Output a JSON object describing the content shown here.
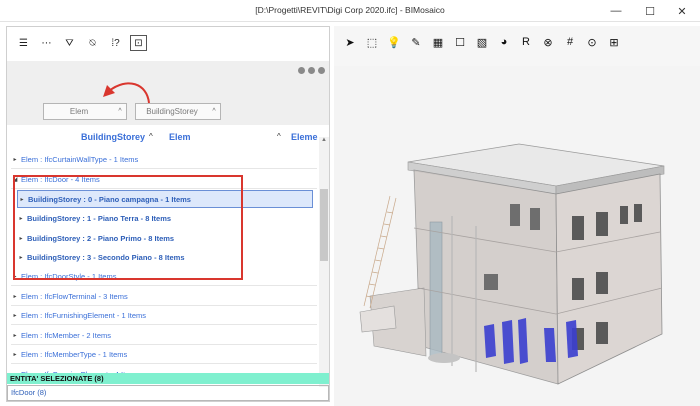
{
  "window": {
    "title": "[D:\\Progetti\\REVIT\\Digi Corp 2020.ifc] - BIMosaico",
    "min_glyph": "—",
    "max_glyph": "☐",
    "close_glyph": "✕"
  },
  "left_toolbar": [
    {
      "name": "list-icon",
      "glyph": "☰"
    },
    {
      "name": "collapse-icon",
      "glyph": "⋯"
    },
    {
      "name": "filter-icon",
      "glyph": "⛛"
    },
    {
      "name": "filter-clear-icon",
      "glyph": "⍉"
    },
    {
      "name": "properties-icon",
      "glyph": "⁞?"
    },
    {
      "name": "inspect-icon",
      "glyph": "⊡"
    }
  ],
  "grouping": {
    "chips": [
      "Elem",
      "BuildingStorey"
    ],
    "caret": "^"
  },
  "columns": [
    "BuildingStorey",
    "Elem",
    "Eleme"
  ],
  "tree": [
    {
      "level": 0,
      "expanded": false,
      "text": "Elem : IfcCurtainWallType - 1 Items"
    },
    {
      "level": 0,
      "expanded": true,
      "text": "Elem : IfcDoor - 4 Items"
    },
    {
      "level": 1,
      "expanded": false,
      "text": "BuildingStorey : 0 - Piano campagna - 1 Items",
      "selected": true
    },
    {
      "level": 1,
      "expanded": false,
      "text": "BuildingStorey : 1 - Piano Terra - 8 Items"
    },
    {
      "level": 1,
      "expanded": false,
      "text": "BuildingStorey : 2 - Piano Primo - 8 Items"
    },
    {
      "level": 1,
      "expanded": false,
      "text": "BuildingStorey : 3 - Secondo Piano - 8 Items"
    },
    {
      "level": 0,
      "expanded": false,
      "text": "Elem : IfcDoorStyle - 1 Items"
    },
    {
      "level": 0,
      "expanded": false,
      "text": "Elem : IfcFlowTerminal - 3 Items"
    },
    {
      "level": 0,
      "expanded": false,
      "text": "Elem : IfcFurnishingElement - 1 Items"
    },
    {
      "level": 0,
      "expanded": false,
      "text": "Elem : IfcMember - 2 Items"
    },
    {
      "level": 0,
      "expanded": false,
      "text": "Elem : IfcMemberType - 1 Items"
    },
    {
      "level": 0,
      "expanded": false,
      "text": "Elem : IfcOpeningElement - 4 Items"
    }
  ],
  "selection": {
    "header": "ENTITA' SELEZIONATE (8)",
    "items": [
      "IfcDoor (8)"
    ]
  },
  "viewer_toolbar": [
    {
      "name": "select-arrow-icon",
      "glyph": "➤"
    },
    {
      "name": "select-box-icon",
      "glyph": "⬚"
    },
    {
      "name": "light-icon",
      "glyph": "💡"
    },
    {
      "name": "brush-icon",
      "glyph": "✎"
    },
    {
      "name": "grid-pattern-icon",
      "glyph": "▦"
    },
    {
      "name": "square-icon",
      "glyph": "☐"
    },
    {
      "name": "hatch-icon",
      "glyph": "▧"
    },
    {
      "name": "palette-icon",
      "glyph": "◕"
    },
    {
      "name": "render-icon",
      "glyph": "R"
    },
    {
      "name": "explode-icon",
      "glyph": "⊗"
    },
    {
      "name": "hash-grid-icon",
      "glyph": "#"
    },
    {
      "name": "camera-icon",
      "glyph": "⊙"
    },
    {
      "name": "section-grid-icon",
      "glyph": "⊞"
    }
  ],
  "colors": {
    "link_blue": "#3a6fd8",
    "highlight_red": "#d9362e",
    "selection_green": "#7ff0cf",
    "selected_doors": "#3b3fd0"
  }
}
